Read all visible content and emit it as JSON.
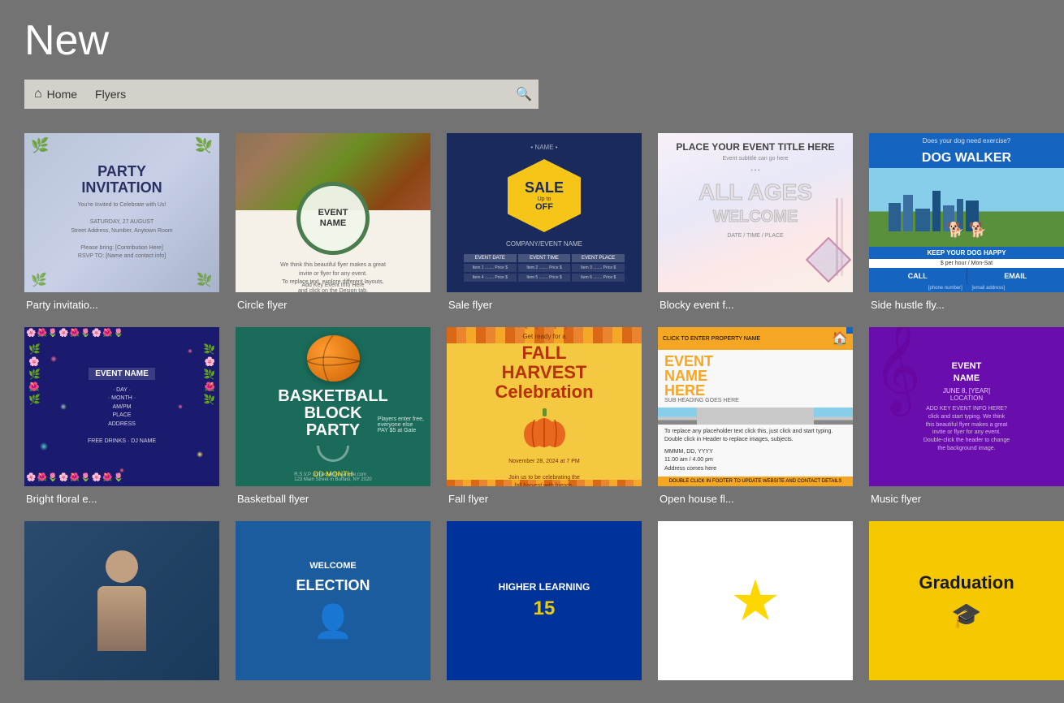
{
  "page": {
    "title": "New"
  },
  "nav": {
    "home_label": "Home",
    "search_placeholder": "Flyers",
    "search_value": "Flyers"
  },
  "templates": {
    "row1": [
      {
        "id": "party-invitation",
        "label": "Party invitatio...",
        "type": "party"
      },
      {
        "id": "circle-flyer",
        "label": "Circle flyer",
        "type": "circle"
      },
      {
        "id": "sale-flyer",
        "label": "Sale flyer",
        "type": "sale"
      },
      {
        "id": "blocky-event-flyer",
        "label": "Blocky event f...",
        "type": "blocky"
      },
      {
        "id": "side-hustle-flyer",
        "label": "Side hustle fly...",
        "type": "dog"
      }
    ],
    "row2": [
      {
        "id": "bright-floral-event",
        "label": "Bright floral e...",
        "type": "floral"
      },
      {
        "id": "basketball-flyer",
        "label": "Basketball flyer",
        "type": "basketball"
      },
      {
        "id": "fall-flyer",
        "label": "Fall flyer",
        "type": "fall"
      },
      {
        "id": "open-house-flyer",
        "label": "Open house fl...",
        "type": "openhouse",
        "has_dot": true
      },
      {
        "id": "music-flyer",
        "label": "Music flyer",
        "type": "music"
      }
    ],
    "row3": [
      {
        "id": "r3-1",
        "label": "",
        "type": "portrait"
      },
      {
        "id": "election-flyer",
        "label": "",
        "type": "election"
      },
      {
        "id": "higher-learning",
        "label": "",
        "type": "higher"
      },
      {
        "id": "star-flyer",
        "label": "",
        "type": "star"
      },
      {
        "id": "graduation-flyer",
        "label": "",
        "type": "graduation"
      }
    ]
  },
  "thumbnails": {
    "party": {
      "title": "PARTY INVITATION",
      "subtitle": "You're Invited to Celebrate with Us!"
    },
    "circle": {
      "event_name": "EVENT NAME",
      "details": "Add Key Event Info Here"
    },
    "sale": {
      "name_label": "• NAME •",
      "sale_text": "SALE",
      "up_to": "Up to",
      "percent": "OFF",
      "company": "COMPANY/EVENT NAME",
      "col1": "EVENT DATE",
      "col2": "EVENT TIME",
      "col3": "EVENT PLACE"
    },
    "blocky": {
      "title": "PLACE YOUR EVENT TITLE HERE",
      "subtitle": "Event Subtitle Can Go Here",
      "line1": "ALL AGES",
      "line2": "WELCOME"
    },
    "dog": {
      "top": "Does your dog need exercise?",
      "name": "DOG WALKER",
      "mid": "KEEP YOUR DOG HAPPY",
      "price": "$ per hour / Mon-Sat",
      "call": "CALL",
      "email": "EMAIL"
    },
    "floral": {
      "event_name": "EVENT NAME",
      "day": "· DAY ·",
      "month": "· MONTH ·",
      "time": "AM/PM",
      "place": "PLACE",
      "dj": "DJ NAME",
      "drinks": "FREE DRINKS • DJ NAME"
    },
    "basketball": {
      "title": "BASKETBALL BLOCK PARTY",
      "date": "DD MONTH"
    },
    "fall": {
      "get_ready": "Get ready for a",
      "title": "FALL HARVEST Celebration",
      "date": "November 28, 2024 at 7 PM"
    },
    "openhouse": {
      "header": "CLICK TO ENTER PROPERTY NAME",
      "event_name": "EVENT NAME HERE",
      "sub_heading": "SUB HEADING GOES HERE",
      "detail1": "To replace any placeholder text click this, just click and start typing.",
      "date": "MMMM, DD, YYYY",
      "time": "11.00 am / 4.00 pm",
      "address": "Address comes here",
      "footer": "DOUBLE CLICK IN FOOTER TO UPDATE WEBSITE AND CONTACT DETAILS"
    },
    "music": {
      "event_name": "EVENT NAME",
      "date": "JUNE 8, [YEAR]",
      "location": "LOCATION",
      "details": "ADD KEY EVENT INFO HERE"
    },
    "portrait": {},
    "election": {
      "text": "WELCOME ELECTION"
    },
    "higher": {
      "text": "HIGHER LEARNING"
    },
    "star": {},
    "graduation": {
      "text": "Graduation"
    }
  }
}
